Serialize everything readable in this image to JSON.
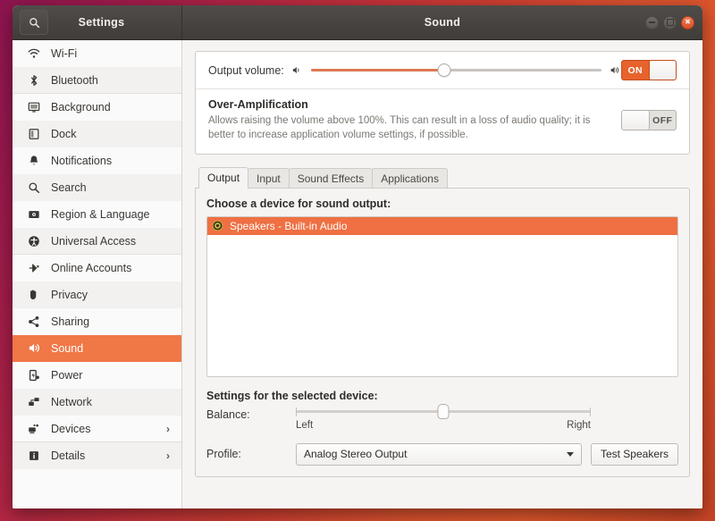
{
  "window": {
    "sidebar_title": "Settings",
    "title": "Sound",
    "search_icon": "search-icon",
    "controls": {
      "minimize": "minimize-button",
      "maximize": "maximize-button",
      "close": "close-button"
    }
  },
  "sidebar": {
    "items": [
      {
        "label": "Wi-Fi",
        "icon": "wifi-icon",
        "selected": false,
        "chevron": ""
      },
      {
        "label": "Bluetooth",
        "icon": "bluetooth-icon",
        "selected": false,
        "chevron": ""
      },
      {
        "label": "Background",
        "icon": "background-icon",
        "selected": false,
        "chevron": ""
      },
      {
        "label": "Dock",
        "icon": "dock-icon",
        "selected": false,
        "chevron": ""
      },
      {
        "label": "Notifications",
        "icon": "bell-icon",
        "selected": false,
        "chevron": ""
      },
      {
        "label": "Search",
        "icon": "magnifier-icon",
        "selected": false,
        "chevron": ""
      },
      {
        "label": "Region & Language",
        "icon": "region-language-icon",
        "selected": false,
        "chevron": ""
      },
      {
        "label": "Universal Access",
        "icon": "universal-access-icon",
        "selected": false,
        "chevron": ""
      },
      {
        "label": "Online Accounts",
        "icon": "online-accounts-icon",
        "selected": false,
        "chevron": ""
      },
      {
        "label": "Privacy",
        "icon": "privacy-hand-icon",
        "selected": false,
        "chevron": ""
      },
      {
        "label": "Sharing",
        "icon": "sharing-icon",
        "selected": false,
        "chevron": ""
      },
      {
        "label": "Sound",
        "icon": "sound-icon",
        "selected": true,
        "chevron": ""
      },
      {
        "label": "Power",
        "icon": "power-icon",
        "selected": false,
        "chevron": ""
      },
      {
        "label": "Network",
        "icon": "network-icon",
        "selected": false,
        "chevron": ""
      },
      {
        "label": "Devices",
        "icon": "devices-icon",
        "selected": false,
        "chevron": "›"
      },
      {
        "label": "Details",
        "icon": "details-info-icon",
        "selected": false,
        "chevron": "›"
      }
    ]
  },
  "main": {
    "output_volume": {
      "label": "Output volume:",
      "low_icon": "volume-low-icon",
      "high_icon": "volume-high-icon",
      "value_percent": 46,
      "toggle_label": "ON",
      "toggle_state": "on"
    },
    "over_amplification": {
      "title": "Over-Amplification",
      "description": "Allows raising the volume above 100%. This can result in a loss of audio quality; it is better to increase application volume settings, if possible.",
      "toggle_label": "OFF",
      "toggle_state": "off"
    },
    "tabs": [
      {
        "label": "Output",
        "active": true
      },
      {
        "label": "Input",
        "active": false
      },
      {
        "label": "Sound Effects",
        "active": false
      },
      {
        "label": "Applications",
        "active": false
      }
    ],
    "output_tab": {
      "choose_label": "Choose a device for sound output:",
      "devices": [
        {
          "label": "Speakers - Built-in Audio",
          "icon": "speaker-device-icon",
          "selected": true
        }
      ],
      "settings_label": "Settings for the selected device:",
      "balance": {
        "label": "Balance:",
        "left_label": "Left",
        "right_label": "Right",
        "value_percent": 50
      },
      "profile": {
        "label": "Profile:",
        "value": "Analog Stereo Output",
        "dropdown_icon": "chevron-down-icon"
      },
      "test_button": "Test Speakers"
    }
  },
  "colors": {
    "accent_orange": "#e8622c",
    "selected_row": "#ef7043",
    "sidebar_selected": "#f07746",
    "slider_fill": "#dd7a55",
    "titlebar": "#474340"
  }
}
